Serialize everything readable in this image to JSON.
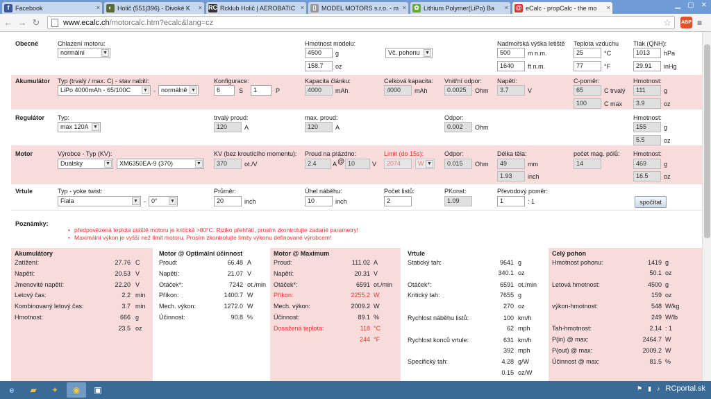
{
  "tabs": [
    {
      "label": "Facebook",
      "icon": "facebook-icon",
      "glyph": "f",
      "color": "#3b5998"
    },
    {
      "label": "Holič (551|396) - Divoké K",
      "icon": "globe-icon",
      "glyph": "◐",
      "color": "#5a6b3a"
    },
    {
      "label": "Rcklub Holič | AEROBATIC",
      "icon": "rc-klub-icon",
      "glyph": "RC",
      "color": "#333"
    },
    {
      "label": "MODEL MOTORS s.r.o. - m",
      "icon": "page-icon",
      "glyph": "▯",
      "color": "#999"
    },
    {
      "label": "Lithium Polymer(LiPo) Ba",
      "icon": "leaf-icon",
      "glyph": "✿",
      "color": "#6a3"
    },
    {
      "label": "eCalc - propCalc - the mo",
      "icon": "ecalc-icon",
      "glyph": "@",
      "color": "#d33"
    }
  ],
  "url": {
    "host": "www.ecalc.ch",
    "path": "/motorcalc.htm?ecalc&lang=cz"
  },
  "general": {
    "title": "Obecné",
    "cooling_label": "Chlazení motoru:",
    "cooling_value": "normální",
    "model_weight_label": "Hmotnost modelu:",
    "weight_g": "4500",
    "unit_g": "g",
    "weight_oz": "158.7",
    "unit_oz": "oz",
    "drive_value": "Vč. pohonu",
    "altitude_label": "Nadmořská výška letiště",
    "alt_m": "500",
    "unit_m": "m n.m.",
    "alt_ft": "1640",
    "unit_ft": "ft n.m.",
    "temp_label": "Teplota vzduchu",
    "temp_c": "25",
    "unit_c": "°C",
    "temp_f": "77",
    "unit_f": "°F",
    "pressure_label": "Tlak (QNH):",
    "press_hpa": "1013",
    "unit_hpa": "hPa",
    "press_inhg": "29.91",
    "unit_inhg": "inHg"
  },
  "battery": {
    "title": "Akumulátor",
    "type_label": "Typ (trvalý / max. C) - stav nabití:",
    "type_value": "LiPo 4000mAh - 65/100C",
    "dash": "-",
    "charge_value": "normálně",
    "config_label": "Konfigurace:",
    "config_s": "6",
    "s_label": "S",
    "config_p": "1",
    "p_label": "P",
    "cell_cap_label": "Kapacita článku:",
    "cell_cap": "4000",
    "unit_mah": "mAh",
    "total_cap_label": "Celková kapacita:",
    "total_cap": "4000",
    "res_label": "Vnitřní odpor:",
    "res": "0.0025",
    "unit_ohm": "Ohm",
    "volt_label": "Napětí:",
    "volt": "3.7",
    "unit_v": "V",
    "crate_label": "C-poměr:",
    "c_cont": "65",
    "c_cont_label": "C trvalý",
    "c_max": "100",
    "c_max_label": "C max",
    "weight_label": "Hmotnost:",
    "w_g": "111",
    "w_oz": "3.9"
  },
  "esc": {
    "title": "Regulátor",
    "type_label": "Typ:",
    "type_value": "max 120A",
    "cont_label": "trvalý proud:",
    "cont": "120",
    "unit_a": "A",
    "max_label": "max. proud:",
    "max": "120",
    "res_label": "Odpor:",
    "res": "0.002",
    "weight_label": "Hmotnost:",
    "w_g": "155",
    "w_oz": "5.5"
  },
  "motor": {
    "title": "Motor",
    "maker_label": "Výrobce - Typ (KV):",
    "maker_value": "Dualsky",
    "model_value": "XM6350EA-9 (370)",
    "kv_label": "KV (bez kroutícího momentu):",
    "kv": "370",
    "unit_kv": "ot./V",
    "noload_label": "Proud na prázdno:",
    "noload_a": "2.4",
    "at_sign": "@",
    "noload_v": "10",
    "limit_label": "Limit (do 15s):",
    "limit": "2074",
    "limit_unit": "W",
    "res_label": "Odpor:",
    "res": "0.015",
    "length_label": "Délka těla:",
    "length_mm": "49",
    "unit_mm": "mm",
    "length_in": "1.93",
    "unit_inch": "inch",
    "poles_label": "počet mag. pólů:",
    "poles": "14",
    "weight_label": "Hmotnost:",
    "w_g": "469",
    "w_oz": "16.5"
  },
  "prop": {
    "title": "Vrtule",
    "type_label": "Typ - yoke twist:",
    "type_value": "Fiala",
    "twist_value": "0°",
    "diam_label": "Průměr:",
    "diam": "20",
    "unit_inch": "inch",
    "pitch_label": "Úhel náběhu:",
    "pitch": "10",
    "blades_label": "Počet listů:",
    "blades": "2",
    "pconst_label": "PKonst:",
    "pconst": "1.09",
    "gear_label": "Převodový poměr:",
    "gear": "1",
    "gear_suffix": ": 1",
    "calc_button": "spočítat"
  },
  "notes": {
    "title": "Poznámky:",
    "items": [
      "předpovězená teplota pláště motoru je kritická >80°C. Riziko přehřátí, prosím zkontrolujte zadané parametry!",
      "Maximální výkon je vyšší než limit motoru. Prosím zkontrolujte limity výkonu definované výrobcem!"
    ]
  },
  "results": {
    "battery": {
      "title": "Akumulátory",
      "rows": [
        {
          "label": "Zatížení:",
          "value": "27.76",
          "unit": "C"
        },
        {
          "label": "Napětí:",
          "value": "20.53",
          "unit": "V"
        },
        {
          "label": "Jmenovité napětí:",
          "value": "22.20",
          "unit": "V"
        },
        {
          "label": "Letový čas:",
          "value": "2.2",
          "unit": "min"
        },
        {
          "label": "Kombinovaný letový čas:",
          "value": "3.7",
          "unit": "min"
        },
        {
          "label": "Hmotnost:",
          "value": "666",
          "unit": "g"
        },
        {
          "label": "",
          "value": "23.5",
          "unit": "oz"
        }
      ]
    },
    "motor_opt": {
      "title": "Motor @ Optimální účinnost",
      "rows": [
        {
          "label": "Proud:",
          "value": "66.48",
          "unit": "A"
        },
        {
          "label": "Napětí:",
          "value": "21.07",
          "unit": "V"
        },
        {
          "label": "Otáček*:",
          "value": "7242",
          "unit": "ot./min"
        },
        {
          "label": "Příkon:",
          "value": "1400.7",
          "unit": "W"
        },
        {
          "label": "Mech. výkon:",
          "value": "1272.0",
          "unit": "W"
        },
        {
          "label": "Účinnost:",
          "value": "90.8",
          "unit": "%"
        }
      ]
    },
    "motor_max": {
      "title": "Motor @ Maximum",
      "rows": [
        {
          "label": "Proud:",
          "value": "111.02",
          "unit": "A",
          "red": false
        },
        {
          "label": "Napětí:",
          "value": "20.31",
          "unit": "V",
          "red": false
        },
        {
          "label": "Otáček*:",
          "value": "6591",
          "unit": "ot./min",
          "red": false
        },
        {
          "label": "Příkon:",
          "value": "2255.2",
          "unit": "W",
          "red": true
        },
        {
          "label": "Mech. výkon:",
          "value": "2009.2",
          "unit": "W",
          "red": false
        },
        {
          "label": "Účinnost:",
          "value": "89.1",
          "unit": "%",
          "red": false
        },
        {
          "label": "Dosažená teplota:",
          "value": "118",
          "unit": "°C",
          "red": true
        },
        {
          "label": "",
          "value": "244",
          "unit": "°F",
          "red": true
        }
      ]
    },
    "prop": {
      "title": "Vrtule",
      "rows": [
        {
          "label": "Statický tah:",
          "value": "9641",
          "unit": "g"
        },
        {
          "label": "",
          "value": "340.1",
          "unit": "oz"
        },
        {
          "label": "Otáček*:",
          "value": "6591",
          "unit": "ot./min"
        },
        {
          "label": "Kritický tah:",
          "value": "7655",
          "unit": "g"
        },
        {
          "label": "",
          "value": "270",
          "unit": "oz"
        },
        {
          "label": "Rychlost náběhu listů:",
          "value": "100",
          "unit": "km/h"
        },
        {
          "label": "",
          "value": "62",
          "unit": "mph"
        },
        {
          "label": "Rychlost konců vrtule:",
          "value": "631",
          "unit": "km/h"
        },
        {
          "label": "",
          "value": "392",
          "unit": "mph"
        },
        {
          "label": "Specifický tah:",
          "value": "4.28",
          "unit": "g/W"
        },
        {
          "label": "",
          "value": "0.15",
          "unit": "oz/W"
        }
      ]
    },
    "drive": {
      "title": "Celý pohon",
      "rows": [
        {
          "label": "Hmotnost pohonu:",
          "value": "1419",
          "unit": "g"
        },
        {
          "label": "",
          "value": "50.1",
          "unit": "oz"
        },
        {
          "label": "Letová hmotnost:",
          "value": "4500",
          "unit": "g"
        },
        {
          "label": "",
          "value": "159",
          "unit": "oz"
        },
        {
          "label": "výkon-hmotnost:",
          "value": "548",
          "unit": "W/kg"
        },
        {
          "label": "",
          "value": "249",
          "unit": "W/lb"
        },
        {
          "label": "Tah-hmotnost:",
          "value": "2.14",
          "unit": ": 1"
        },
        {
          "label": "P(in) @ max:",
          "value": "2464.7",
          "unit": "W"
        },
        {
          "label": "P(out) @ max:",
          "value": "2009.2",
          "unit": "W"
        },
        {
          "label": "Účinnost @ max:",
          "value": "81.5",
          "unit": "%"
        }
      ]
    }
  },
  "taskbar": {
    "tray_label": "RCportal.sk"
  }
}
